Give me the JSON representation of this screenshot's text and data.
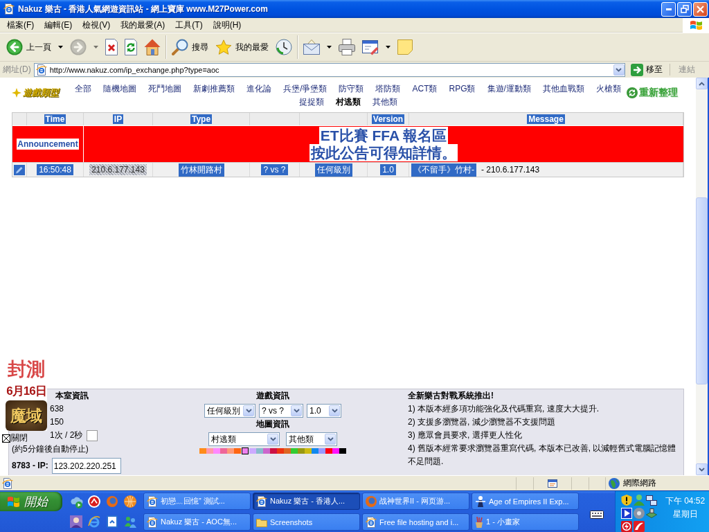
{
  "window": {
    "title": "Nakuz 樂古 - 香港人氣網遊資訊站 - 網上寶庫 www.M27Power.com"
  },
  "menu_bar": [
    "檔案(F)",
    "編輯(E)",
    "檢視(V)",
    "我的最愛(A)",
    "工具(T)",
    "說明(H)"
  ],
  "toolbar": {
    "groups": [
      {
        "buttons": [
          {
            "kind": "back",
            "label": "上一頁",
            "disabled": false,
            "dropdown": true
          },
          {
            "kind": "forward",
            "disabled": true,
            "dropdown": true
          },
          {
            "kind": "stop",
            "disabled": false,
            "dropdown": false
          },
          {
            "kind": "refresh",
            "disabled": false,
            "dropdown": false
          },
          {
            "kind": "home",
            "disabled": false,
            "dropdown": false
          }
        ]
      },
      {
        "buttons": [
          {
            "kind": "search",
            "label": "搜尋",
            "disabled": false,
            "dropdown": false
          },
          {
            "kind": "favorites",
            "label": "我的最愛",
            "disabled": false,
            "dropdown": false
          },
          {
            "kind": "history",
            "disabled": false,
            "dropdown": false
          }
        ]
      },
      {
        "buttons": [
          {
            "kind": "mail",
            "disabled": false,
            "dropdown": true
          },
          {
            "kind": "print",
            "disabled": false,
            "dropdown": false
          },
          {
            "kind": "edit",
            "disabled": false,
            "dropdown": true
          },
          {
            "kind": "note",
            "disabled": false,
            "dropdown": false
          }
        ]
      }
    ]
  },
  "address_bar": {
    "label": "網址(D)",
    "url": "http://www.nakuz.com/ip_exchange.php?type=aoc",
    "go": "移至",
    "links": "連結"
  },
  "page": {
    "header": {
      "logo": "遊戲類型",
      "categories": [
        {
          "label": "全部",
          "selected": false
        },
        {
          "label": "隨機地圖",
          "selected": false
        },
        {
          "label": "死鬥地圖",
          "selected": false
        },
        {
          "label": "新劇推薦類",
          "selected": false
        },
        {
          "label": "進化論",
          "selected": false
        },
        {
          "label": "兵堡/爭堡類",
          "selected": false
        },
        {
          "label": "防守類",
          "selected": false
        },
        {
          "label": "塔防類",
          "selected": false
        },
        {
          "label": "ACT類",
          "selected": false
        },
        {
          "label": "RPG類",
          "selected": false
        },
        {
          "label": "集遊/運動類",
          "selected": false
        },
        {
          "label": "其他血戰類",
          "selected": false
        },
        {
          "label": "火槍類",
          "selected": false
        },
        {
          "label": "捉捉類",
          "selected": false
        },
        {
          "label": "村逃類",
          "selected": true
        },
        {
          "label": "其他類",
          "selected": false
        }
      ],
      "refresh": "重新整理"
    },
    "table": {
      "columns": [
        {
          "label": "Time",
          "highlighted": true
        },
        {
          "label": "IP",
          "highlighted": true
        },
        {
          "label": "Type",
          "highlighted": true
        },
        {},
        {},
        {
          "label": "Version",
          "highlighted": true
        },
        {
          "label": "Message",
          "highlighted": true
        }
      ],
      "announcement": {
        "label": "Announcement",
        "lines": [
          "ET比賽 FFA 報名區",
          "按此公告可得知詳情。"
        ]
      },
      "rows": [
        {
          "cells": [
            {
              "kind": "text",
              "text": "16:50:48",
              "highlighted": true
            },
            {
              "kind": "dotted",
              "text": "210.6.177.143",
              "highlighted": true
            },
            {
              "kind": "text",
              "text": "竹林開路村",
              "highlighted": true
            },
            {
              "kind": "text",
              "text": "? vs ?",
              "highlighted": true
            },
            {
              "kind": "text",
              "text": "任何級別",
              "highlighted": true
            },
            {
              "kind": "text",
              "text": "1.0",
              "highlighted": true
            },
            {
              "kind": "text",
              "parts": [
                {
                  "text": "《不留手》竹村-",
                  "highlighted": true
                },
                {
                  "text": "- 210.6.177.143",
                  "highlighted": false
                }
              ]
            }
          ]
        }
      ]
    },
    "ad": {
      "lines": [
        "封測",
        "6月16日"
      ],
      "logo": "魔域",
      "close": "關閉"
    },
    "room_info": {
      "title": "本室資訊",
      "values": [
        "638",
        "150"
      ],
      "auto_refresh": {
        "label": "1次 / 2秒",
        "checked": false
      },
      "note": "(約5分鐘後自動停止)",
      "ip": {
        "label": "8783 - IP:",
        "value": "123.202.220.251"
      }
    },
    "game_info": {
      "title": "遊戲資訊",
      "selects": [
        "任何級別",
        "? vs ?",
        "1.0"
      ]
    },
    "map_info": {
      "title": "地圖資訊",
      "selects": [
        "村逃類",
        "其他類"
      ],
      "swatches": [
        {
          "color": "#ff8c1a",
          "selected": false
        },
        {
          "color": "#ff99aa",
          "selected": false
        },
        {
          "color": "#ff88ff",
          "selected": false
        },
        {
          "color": "#ee6699",
          "selected": false
        },
        {
          "color": "#ff9977",
          "selected": false
        },
        {
          "color": "#ff6611",
          "selected": false
        },
        {
          "color": "#ee82ee",
          "selected": true
        },
        {
          "color": "#ccaaff",
          "selected": false
        },
        {
          "color": "#88bbcc",
          "selected": false
        },
        {
          "color": "#cc66cc",
          "selected": false
        },
        {
          "color": "#cc1144",
          "selected": false
        },
        {
          "color": "#ee3311",
          "selected": false
        },
        {
          "color": "#dd6622",
          "selected": false
        },
        {
          "color": "#33cc33",
          "selected": false
        },
        {
          "color": "#999911",
          "selected": false
        },
        {
          "color": "#ccbb11",
          "selected": false
        },
        {
          "color": "#1188ee",
          "selected": false
        },
        {
          "color": "#9999ff",
          "selected": false
        },
        {
          "color": "#ff0011",
          "selected": false
        },
        {
          "color": "#ff11ff",
          "selected": false
        },
        {
          "color": "#000000",
          "selected": false
        }
      ]
    },
    "news": {
      "title": "全新樂古對戰系統推出!",
      "items": [
        "1) 本版本經多項功能強化及代碼重寫, 速度大大提升.",
        "2) 支援多瀏覽器, 減少瀏覽器不支援問題",
        "3) 應眾會員要求, 選擇更人性化",
        "4) 舊版本經常要求瀏覽器重寫代碼, 本版本已改善, 以減輕舊式電腦記憶體不足問題."
      ]
    }
  },
  "status_bar": {
    "zone": "網際網路"
  },
  "taskbar": {
    "start": "開始",
    "tasks": [
      {
        "label": "初戀﹏回憶” 測試...",
        "selected": false
      },
      {
        "label": "Nakuz 樂古 - 香港人...",
        "selected": true
      },
      {
        "label": "战神世界II - 网页游...",
        "selected": false
      },
      {
        "label": "Age of Empires II Exp...",
        "selected": false
      },
      {
        "label": "Nakuz 樂古 - AOC無...",
        "selected": false
      },
      {
        "label": "Screenshots",
        "selected": false
      },
      {
        "label": "Free file hosting and i...",
        "selected": false
      },
      {
        "label": "1 - 小畫家",
        "selected": false
      }
    ],
    "clock": {
      "time": "下午 04:52",
      "day": "星期日"
    }
  }
}
